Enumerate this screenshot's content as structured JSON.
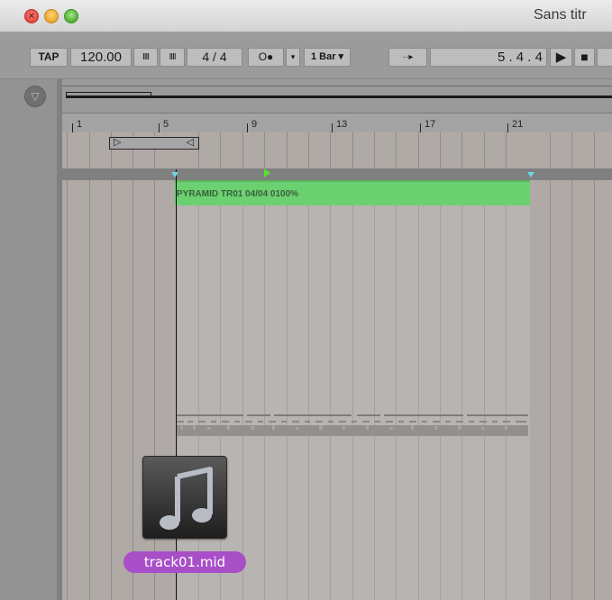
{
  "window": {
    "title": "Sans titr"
  },
  "transport": {
    "tap_label": "TAP",
    "tempo": "120.00",
    "nudge_down": "IIII",
    "nudge_up": "IIII",
    "time_signature": "4 / 4",
    "metronome": "O●",
    "dropdown_arrow": "▾",
    "quantization": "1 Bar ▾",
    "follow": "··▸",
    "position": "5 .  4 .  4",
    "play": "▶",
    "stop": "■"
  },
  "sidebar": {
    "fold_icon": "▽"
  },
  "ruler": {
    "bars": [
      "1",
      "5",
      "9",
      "13",
      "17",
      "21"
    ]
  },
  "loop_brace": {
    "left": "▷",
    "right": "◁"
  },
  "clip": {
    "name": "PYRAMID TR01 04/04 0100%",
    "color": "#6bd170"
  },
  "dragged_file": {
    "name": "track01.mid",
    "icon": "music-note-icon",
    "label_color": "#a84fc8"
  }
}
